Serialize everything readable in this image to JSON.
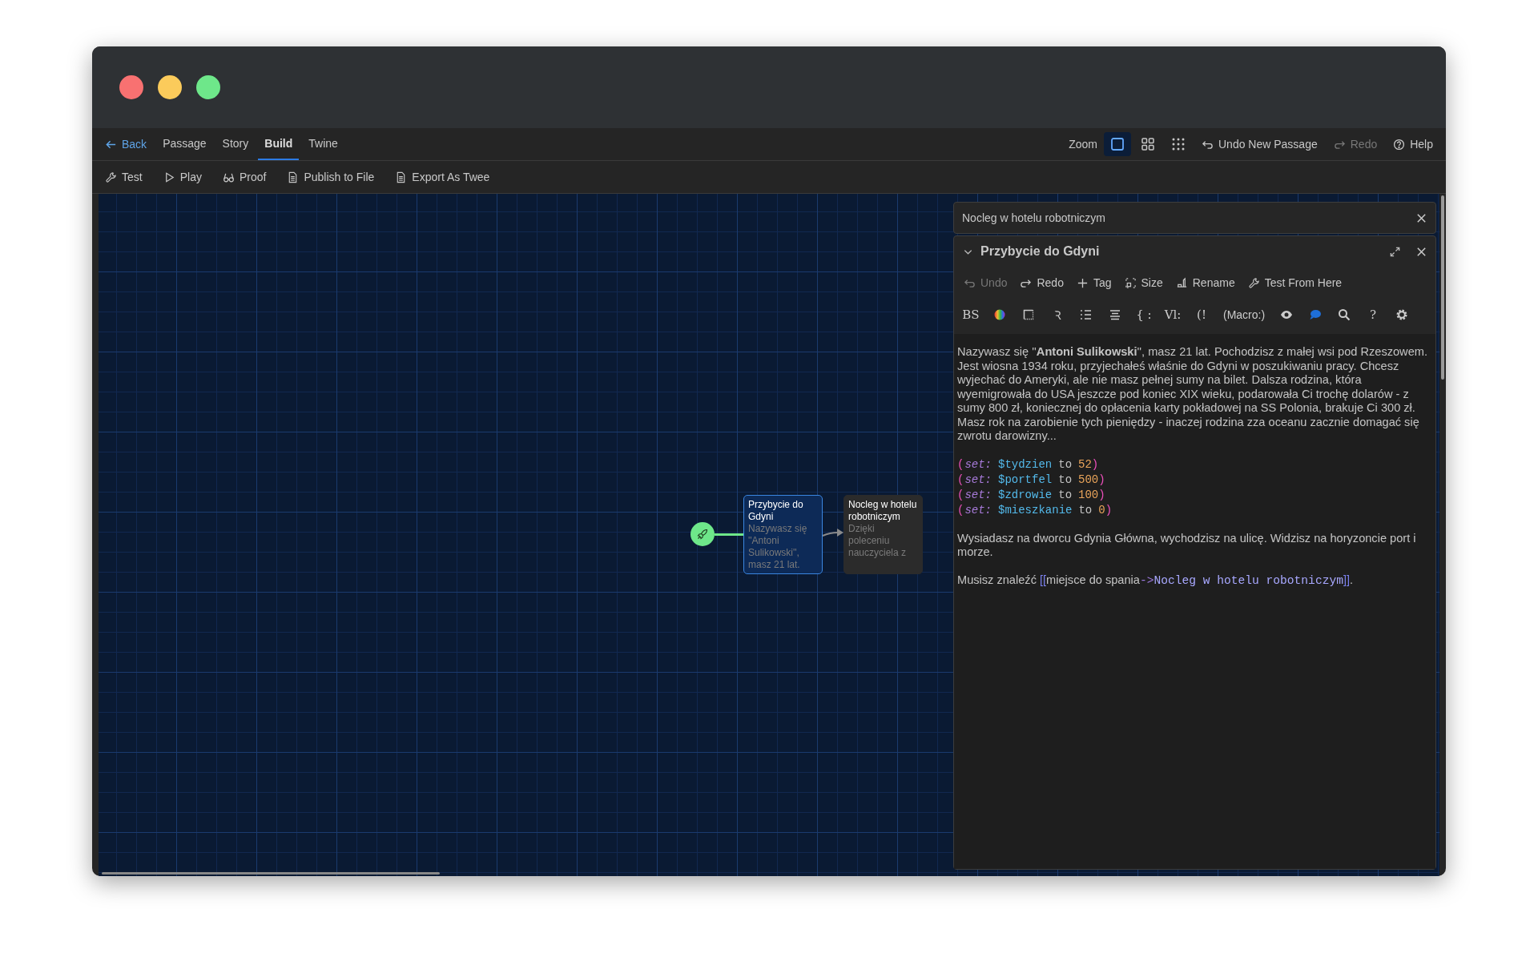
{
  "menu": {
    "back": "Back",
    "tabs": [
      {
        "label": "Passage",
        "selected": false
      },
      {
        "label": "Story",
        "selected": false
      },
      {
        "label": "Build",
        "selected": true
      },
      {
        "label": "Twine",
        "selected": false
      }
    ],
    "zoom_label": "Zoom",
    "zoom_options": [
      {
        "kind": "single",
        "selected": true
      },
      {
        "kind": "four",
        "selected": false
      },
      {
        "kind": "nine",
        "selected": false
      }
    ],
    "actions": [
      {
        "kind": "undo",
        "label": "Undo New Passage",
        "disabled": false
      },
      {
        "kind": "redo",
        "label": "Redo",
        "disabled": true
      },
      {
        "kind": "help",
        "label": "Help",
        "disabled": false
      }
    ]
  },
  "toolbar": [
    {
      "kind": "wrench",
      "label": "Test"
    },
    {
      "kind": "play",
      "label": "Play"
    },
    {
      "kind": "glasses",
      "label": "Proof"
    },
    {
      "kind": "file",
      "label": "Publish to File"
    },
    {
      "kind": "file",
      "label": "Export As Twee"
    }
  ],
  "canvas": {
    "passages": [
      {
        "title": "Przybycie do Gdyni",
        "excerpt": "Nazywasz się ''Antoni Sulikowski'', masz 21 lat.",
        "selected": true,
        "start": true
      },
      {
        "title": "Nocleg w hotelu robotniczym",
        "excerpt": "Dzięki poleceniu nauczyciela z",
        "selected": false,
        "start": false
      }
    ]
  },
  "dialogs": [
    {
      "title": "Nocleg w hotelu robotniczym",
      "expanded": false
    },
    {
      "title": "Przybycie do Gdyni",
      "expanded": true,
      "actions": [
        {
          "kind": "undo",
          "label": "Undo",
          "disabled": true
        },
        {
          "kind": "redo",
          "label": "Redo",
          "disabled": false
        },
        {
          "kind": "plus",
          "label": "Tag",
          "disabled": false
        },
        {
          "kind": "size",
          "label": "Size",
          "disabled": false
        },
        {
          "kind": "rename",
          "label": "Rename",
          "disabled": false
        },
        {
          "kind": "wrench",
          "label": "Test From Here",
          "disabled": false
        }
      ],
      "format_tools": [
        {
          "kind": "text",
          "label": "BS"
        },
        {
          "kind": "colors"
        },
        {
          "kind": "frame"
        },
        {
          "kind": "text",
          "label": "Ꝛ"
        },
        {
          "kind": "list"
        },
        {
          "kind": "align"
        },
        {
          "kind": "text",
          "label": "{ :"
        },
        {
          "kind": "text",
          "label": "Vl:"
        },
        {
          "kind": "text",
          "label": "(!"
        },
        {
          "kind": "text",
          "label": "(Macro:)"
        },
        {
          "kind": "eye"
        },
        {
          "kind": "bubble"
        },
        {
          "kind": "search"
        },
        {
          "kind": "text",
          "label": "?"
        },
        {
          "kind": "gear"
        }
      ],
      "body": [
        {
          "kind": "prose",
          "text": "Nazywasz się ''**Antoni Sulikowski**'', masz 21 lat. Pochodzisz z małej wsi pod Rzeszowem. Jest wiosna 1934 roku, przyjechałeś właśnie do Gdyni w poszukiwaniu pracy. Chcesz wyjechać do Ameryki, ale nie masz pełnej sumy na bilet. Dalsza rodzina, która wyemigrowała do USA jeszcze pod koniec XIX wieku, podarowała Ci trochę dolarów - z sumy 800 zł, koniecznej do opłacenia karty pokładowej na SS Polonia, brakuje Ci 300 zł. Masz rok na zarobienie tych pieniędzy - inaczej rodzina zza oceanu zacznie domagać się zwrotu darowizny..."
        },
        {
          "kind": "code",
          "lines": [
            [
              {
                "kind": "paren",
                "text": "("
              },
              {
                "kind": "macro",
                "text": "set:"
              },
              {
                "kind": "variable",
                "text": "$tydzien"
              },
              {
                "kind": "keyword",
                "text": "to"
              },
              {
                "kind": "number",
                "text": "52"
              },
              {
                "kind": "paren",
                "text": ")"
              }
            ],
            [
              {
                "kind": "paren",
                "text": "("
              },
              {
                "kind": "macro",
                "text": "set:"
              },
              {
                "kind": "variable",
                "text": "$portfel"
              },
              {
                "kind": "keyword",
                "text": "to"
              },
              {
                "kind": "number",
                "text": "500"
              },
              {
                "kind": "paren",
                "text": ")"
              }
            ],
            [
              {
                "kind": "paren",
                "text": "("
              },
              {
                "kind": "macro",
                "text": "set:"
              },
              {
                "kind": "variable",
                "text": "$zdrowie"
              },
              {
                "kind": "keyword",
                "text": "to"
              },
              {
                "kind": "number",
                "text": "100"
              },
              {
                "kind": "paren",
                "text": ")"
              }
            ],
            [
              {
                "kind": "paren",
                "text": "("
              },
              {
                "kind": "macro",
                "text": "set:"
              },
              {
                "kind": "variable",
                "text": "$mieszkanie"
              },
              {
                "kind": "keyword",
                "text": "to"
              },
              {
                "kind": "number",
                "text": "0"
              },
              {
                "kind": "paren",
                "text": ")"
              }
            ]
          ]
        },
        {
          "kind": "prose",
          "text": "Wysiadasz na dworcu Gdynia Główna, wychodzisz na ulicę. Widzisz na horyzoncie port i morze."
        },
        {
          "kind": "link",
          "before": "Musisz znaleźć",
          "open": "[[",
          "label": "miejsce do spania",
          "arrow": "->",
          "target": "Nocleg w hotelu robotniczym",
          "close": "]]",
          "after": "."
        }
      ]
    }
  ]
}
